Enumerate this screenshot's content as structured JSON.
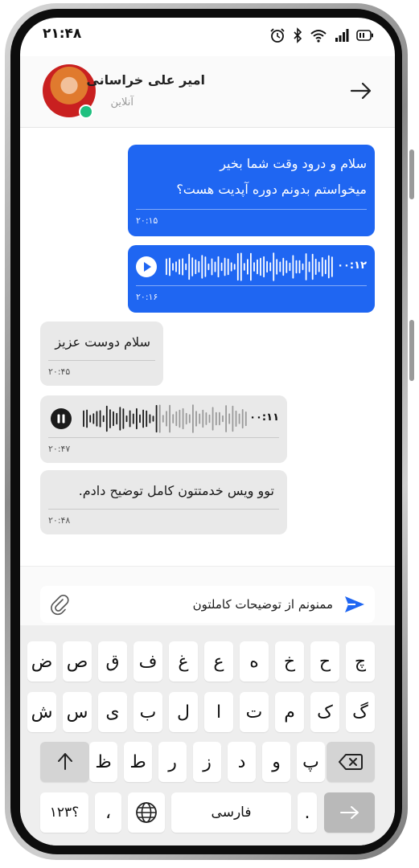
{
  "status_bar": {
    "time": "۲۱:۴۸"
  },
  "header": {
    "name": "امیر علی خراسانی",
    "status": "آنلاین"
  },
  "messages": [
    {
      "line1": "سلام و درود وقت شما بخیر",
      "line2": "میخواستم بدونم دوره آپدیت هست؟",
      "time": "۲۰:۱۵"
    },
    {
      "duration": "۰۰:۱۲",
      "time": "۲۰:۱۶"
    },
    {
      "text": "سلام دوست عزیز",
      "time": "۲۰:۴۵"
    },
    {
      "duration": "۰۰:۱۱",
      "time": "۲۰:۴۷"
    },
    {
      "text": "توو ویس خدمتتون کامل توضیح دادم.",
      "time": "۲۰:۴۸"
    }
  ],
  "composer": {
    "text": "ممنونم از توضیحات کاملتون"
  },
  "keyboard": {
    "row1": [
      "چ",
      "ح",
      "خ",
      "ه",
      "ع",
      "غ",
      "ف",
      "ق",
      "ص",
      "ض"
    ],
    "row2": [
      "گ",
      "ک",
      "م",
      "ت",
      "ا",
      "ل",
      "ب",
      "ی",
      "س",
      "ش"
    ],
    "row3": [
      "پ",
      "و",
      "د",
      "ز",
      "ر",
      "ط",
      "ظ"
    ],
    "numbers_label": "؟۱۲۳",
    "comma_label": "،",
    "space_label": "فارسی",
    "period_label": "."
  }
}
